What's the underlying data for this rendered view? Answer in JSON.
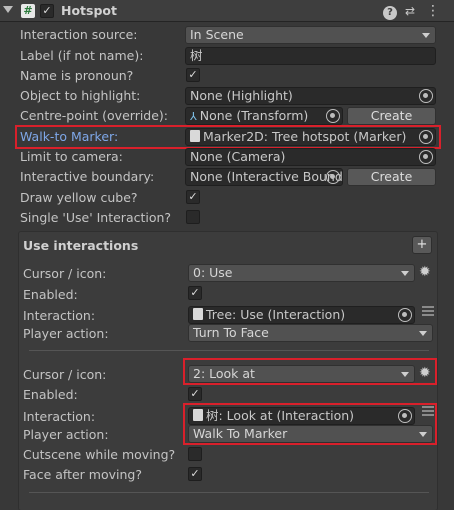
{
  "header": {
    "title": "Hotspot",
    "enabled_check": "✓",
    "help_icon": "?",
    "settings_icon": "⇄",
    "menu_icon": "⋮"
  },
  "rows": {
    "interaction_source": {
      "label": "Interaction source:",
      "value": "In Scene"
    },
    "label_field": {
      "label": "Label (if not name):",
      "value": "树"
    },
    "name_pronoun": {
      "label": "Name is pronoun?",
      "check": "✓"
    },
    "object_highlight": {
      "label": "Object to highlight:",
      "value": "None (Highlight)"
    },
    "centre_point": {
      "label": "Centre-point (override):",
      "value": "None (Transform)",
      "button": "Create"
    },
    "walk_to_marker": {
      "label": "Walk-to Marker:",
      "value": "Marker2D: Tree hotspot (Marker)"
    },
    "limit_camera": {
      "label": "Limit to camera:",
      "value": "None (Camera)"
    },
    "interactive_boundary": {
      "label": "Interactive boundary:",
      "value": "None (Interactive Bound",
      "button": "Create"
    },
    "draw_cube": {
      "label": "Draw yellow cube?",
      "check": "✓"
    },
    "single_use": {
      "label": "Single 'Use' Interaction?",
      "check": ""
    }
  },
  "use_interactions": {
    "title": "Use interactions",
    "add": "+",
    "items": [
      {
        "cursor_label": "Cursor / icon:",
        "cursor_value": "0: Use",
        "enabled_label": "Enabled:",
        "enabled_check": "✓",
        "interaction_label": "Interaction:",
        "interaction_value": "Tree: Use (Interaction)",
        "player_label": "Player action:",
        "player_value": "Turn To Face"
      },
      {
        "cursor_label": "Cursor / icon:",
        "cursor_value": "2: Look at",
        "enabled_label": "Enabled:",
        "enabled_check": "✓",
        "interaction_label": "Interaction:",
        "interaction_value": "树: Look at (Interaction)",
        "player_label": "Player action:",
        "player_value": "Walk To Marker",
        "cutscene_label": "Cutscene while moving?",
        "cutscene_check": "",
        "face_label": "Face after moving?",
        "face_check": "✓"
      }
    ]
  },
  "colors": {
    "highlight_border": "#d9202b",
    "link_label": "#7ea7e8",
    "background": "#383838"
  }
}
